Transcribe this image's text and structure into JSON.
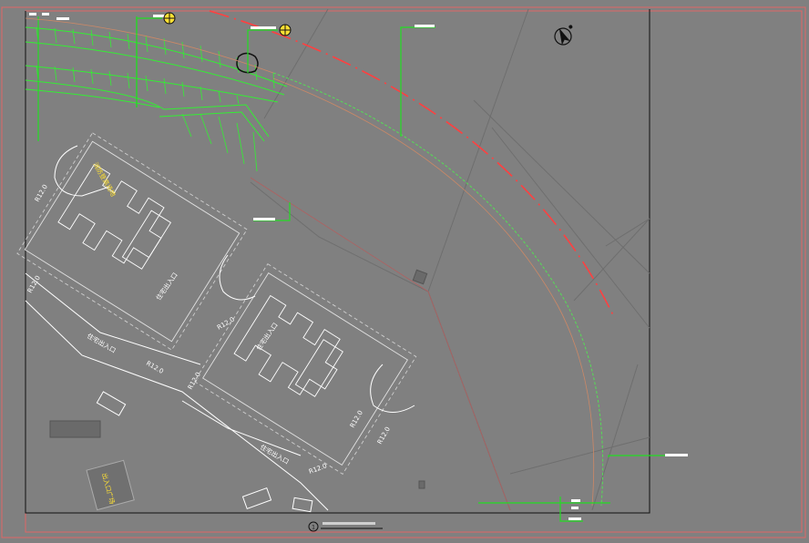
{
  "drawing": {
    "background_color": "#808080",
    "frame_color": "#e06666",
    "label_color": "#ffffff",
    "leader_color": "#22dd22",
    "road_red_color": "#ff4040",
    "yellow_color": "#ffe033",
    "title_marker": "1",
    "north_arrow": "north-arrow-icon"
  },
  "plan_labels": {
    "entrance_a": "住宅出入口",
    "entrance_b": "住宅出入口",
    "entrance_c": "住宅出入口",
    "entrance_d": "住宅出入口",
    "radius_1": "R12.0",
    "radius_2": "R12.0",
    "radius_3": "R12.0",
    "radius_4": "R12.0",
    "radius_5": "R12.0",
    "radius_6": "R12.0",
    "radius_7": "R12.0",
    "radius_8": "R12.0",
    "yellow_tag_1": "消防登高场地",
    "yellow_tag_2": "出入口广场"
  }
}
